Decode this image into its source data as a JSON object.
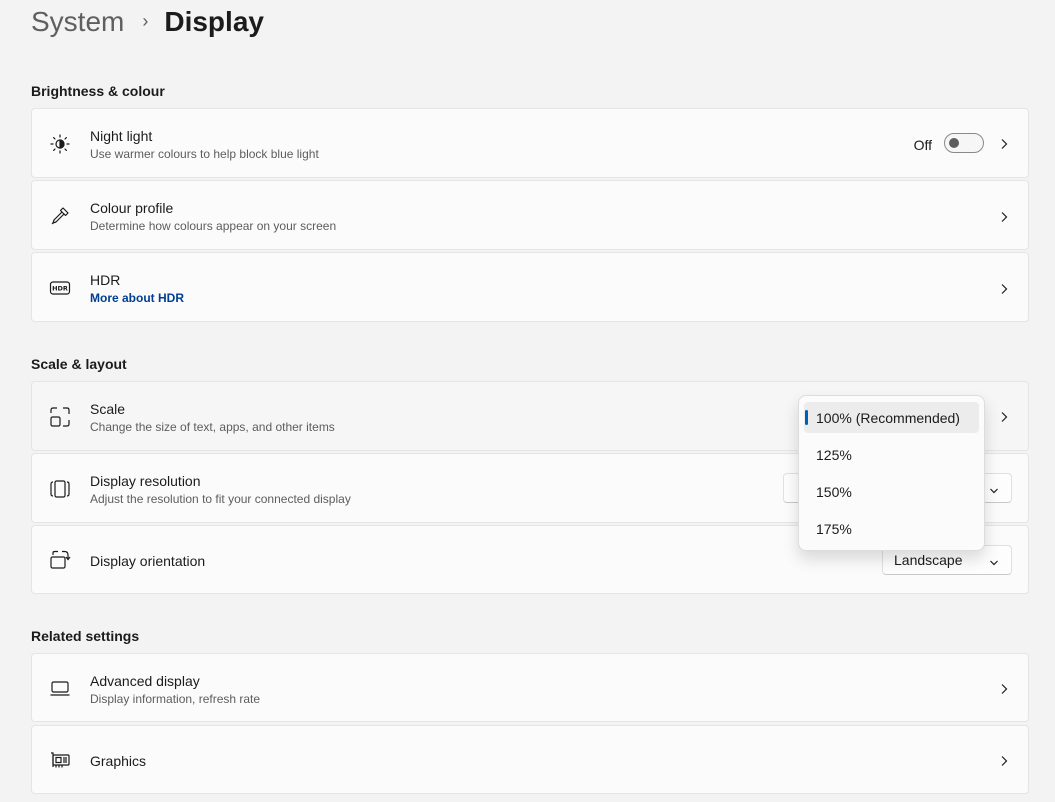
{
  "breadcrumb": {
    "parent": "System",
    "separator": "›",
    "current": "Display"
  },
  "sections": {
    "brightness": "Brightness & colour",
    "scale_layout": "Scale & layout",
    "related": "Related settings"
  },
  "night_light": {
    "title": "Night light",
    "subtitle": "Use warmer colours to help block blue light",
    "toggle_label": "Off",
    "toggle_on": false
  },
  "colour_profile": {
    "title": "Colour profile",
    "subtitle": "Determine how colours appear on your screen"
  },
  "hdr": {
    "title": "HDR",
    "link": "More about HDR"
  },
  "scale": {
    "title": "Scale",
    "subtitle": "Change the size of text, apps, and other items",
    "options": [
      "100% (Recommended)",
      "125%",
      "150%",
      "175%"
    ],
    "selected": "100% (Recommended)"
  },
  "resolution": {
    "title": "Display resolution",
    "subtitle": "Adjust the resolution to fit your connected display"
  },
  "orientation": {
    "title": "Display orientation",
    "value": "Landscape"
  },
  "advanced_display": {
    "title": "Advanced display",
    "subtitle": "Display information, refresh rate"
  },
  "graphics": {
    "title": "Graphics"
  },
  "colors": {
    "accent": "#005fb8",
    "link": "#003e92",
    "background": "#f3f3f3",
    "card": "#fbfbfb"
  },
  "icons": {
    "night_light": "brightness-icon",
    "colour_profile": "eyedropper-icon",
    "hdr": "hdr-icon",
    "scale": "scale-icon",
    "resolution": "resolution-icon",
    "orientation": "orientation-icon",
    "advanced_display": "monitor-icon",
    "graphics": "graphics-card-icon",
    "chevron": "chevron-right-icon",
    "dropdown": "chevron-down-icon"
  }
}
